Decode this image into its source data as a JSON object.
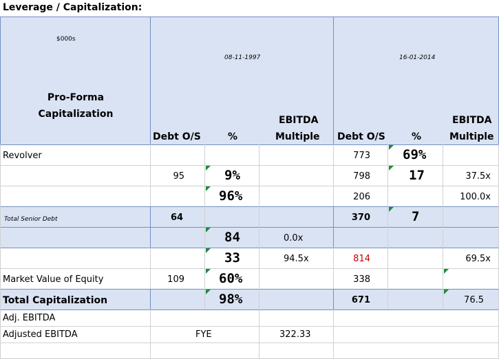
{
  "title": "Leverage / Capitalization:",
  "units": "$000s",
  "dates": [
    "08-11-1997",
    "16-01-2014"
  ],
  "header_left": "Pro-Forma Capitalization",
  "col_headers": {
    "debt": "Debt O/S",
    "pct": "%",
    "ebitda_line1": "EBITDA",
    "ebitda_line2": "Multiple"
  },
  "rows": [
    {
      "label": "Revolver",
      "d1": "",
      "p1": "",
      "e1": "",
      "d2": "773",
      "p2": "69%",
      "e2": ""
    },
    {
      "label": "",
      "d1": "95",
      "p1": "9%",
      "e1": "",
      "d2": "798",
      "p2": "17",
      "e2": "37.5x"
    },
    {
      "label": "",
      "d1": "",
      "p1": "96%",
      "e1": "",
      "d2": "206",
      "p2": "",
      "e2": "100.0x"
    },
    {
      "label": "Total Senior Debt",
      "d1": "64",
      "p1": "",
      "e1": "",
      "d2": "370",
      "p2": "7",
      "e2": ""
    },
    {
      "label": "",
      "d1": "",
      "p1": "84",
      "e1": "0.0x",
      "d2": "",
      "p2": "",
      "e2": ""
    },
    {
      "label": "",
      "d1": "",
      "p1": "33",
      "e1": "94.5x",
      "d2": "814",
      "p2": "",
      "e2": "69.5x"
    },
    {
      "label": "Market Value of Equity",
      "d1": "109",
      "p1": "60%",
      "e1": "",
      "d2": "338",
      "p2": "",
      "e2": ""
    },
    {
      "label": "Total Capitalization",
      "d1": "",
      "p1": "98%",
      "e1": "",
      "d2": "671",
      "p2": "",
      "e2": "76.5"
    }
  ],
  "footer": {
    "adj_ebitda_label": "Adj. EBITDA",
    "adjusted_ebitda_label": "Adjusted EBITDA",
    "fye": "FYE",
    "value": "322.33"
  },
  "colors": {
    "band": "#dae3f3",
    "border": "#6f8fc4",
    "comment_marker": "#1e8c3a",
    "negative_red": "#d00000"
  }
}
